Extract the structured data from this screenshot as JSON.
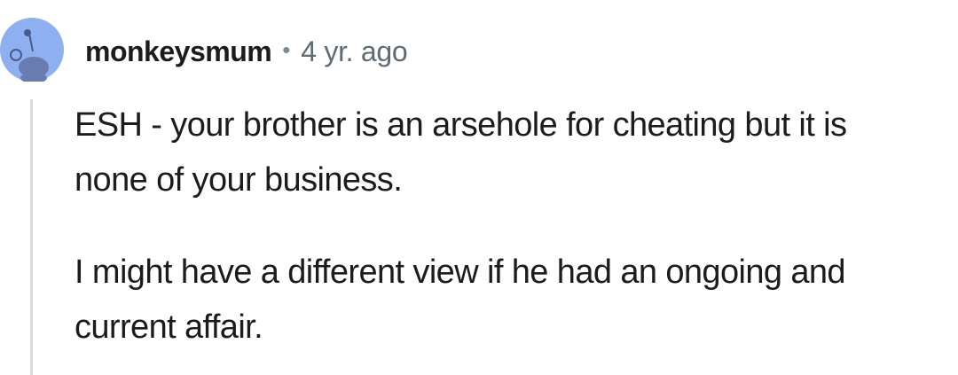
{
  "comment": {
    "author": "monkeysmum",
    "separator": "•",
    "timestamp": "4 yr. ago",
    "avatar_icon": "reddit-snoo-avatar-icon",
    "paragraphs": [
      "ESH - your brother is an arsehole for cheating but it is none of your business.",
      "I might have a different view if he had an ongoing and current affair."
    ]
  },
  "colors": {
    "avatar_bg": "#8fb0f0",
    "avatar_figure": "#5a6a99",
    "thread_line": "#dadde0",
    "text": "#1c1c1c",
    "meta": "#5f6b73"
  }
}
